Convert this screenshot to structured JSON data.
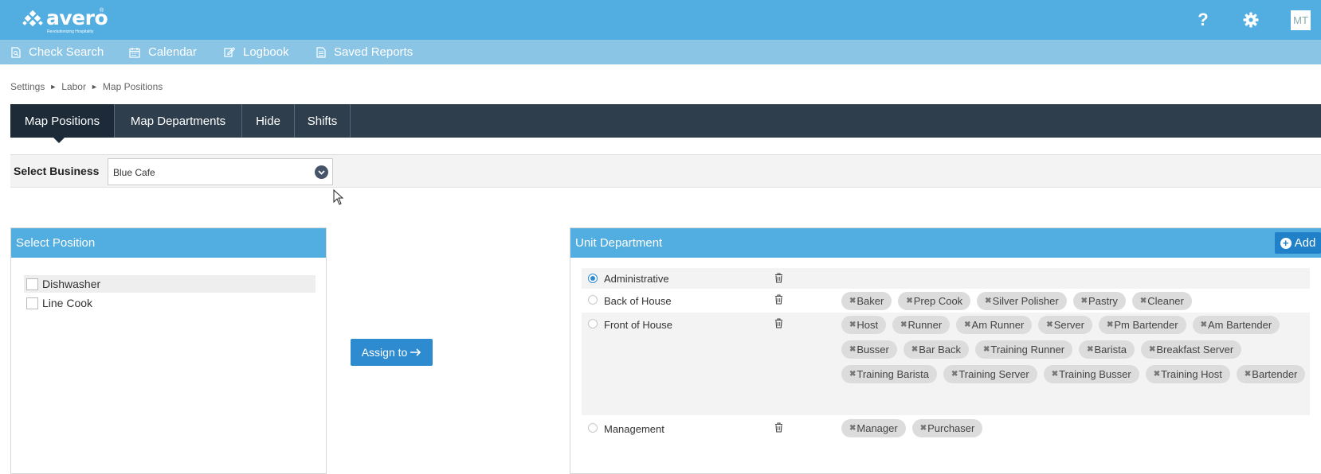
{
  "header": {
    "logo_text": "avero",
    "logo_tagline": "Revolutionizing Hospitality",
    "help_icon": "?",
    "avatar_initials": "MT"
  },
  "nav": {
    "items": [
      {
        "label": "Check Search",
        "icon": "document-search-icon"
      },
      {
        "label": "Calendar",
        "icon": "calendar-icon"
      },
      {
        "label": "Logbook",
        "icon": "edit-icon"
      },
      {
        "label": "Saved Reports",
        "icon": "document-icon"
      }
    ]
  },
  "breadcrumb": {
    "items": [
      "Settings",
      "Labor",
      "Map Positions"
    ],
    "separator": "►"
  },
  "tabs": [
    {
      "label": "Map Positions",
      "active": true
    },
    {
      "label": "Map Departments",
      "active": false
    },
    {
      "label": "Hide",
      "active": false
    },
    {
      "label": "Shifts",
      "active": false
    }
  ],
  "business": {
    "label": "Select Business",
    "selected": "Blue Cafe"
  },
  "positions_panel": {
    "title": "Select Position",
    "items": [
      {
        "label": "Dishwasher",
        "checked": false
      },
      {
        "label": "Line Cook",
        "checked": false
      }
    ]
  },
  "assign_button": {
    "label": "Assign to"
  },
  "departments_panel": {
    "title": "Unit Department",
    "add_label": "Add",
    "departments": [
      {
        "name": "Administrative",
        "selected": true,
        "positions": []
      },
      {
        "name": "Back of House",
        "selected": false,
        "positions": [
          "Baker",
          "Prep Cook",
          "Silver Polisher",
          "Pastry",
          "Cleaner"
        ]
      },
      {
        "name": "Front of House",
        "selected": false,
        "positions": [
          "Host",
          "Runner",
          "Am Runner",
          "Server",
          "Pm Bartender",
          "Am Bartender",
          "Busser",
          "Bar Back",
          "Training Runner",
          "Barista",
          "Breakfast Server",
          "Training Barista",
          "Training Server",
          "Training Busser",
          "Training Host",
          "Bartender"
        ]
      },
      {
        "name": "Management",
        "selected": false,
        "positions": [
          "Manager",
          "Purchaser"
        ]
      }
    ]
  },
  "colors": {
    "header": "#52ade0",
    "nav": "#8ac5e6",
    "tabbar": "#2f3e4d",
    "button": "#2e8bd0"
  }
}
